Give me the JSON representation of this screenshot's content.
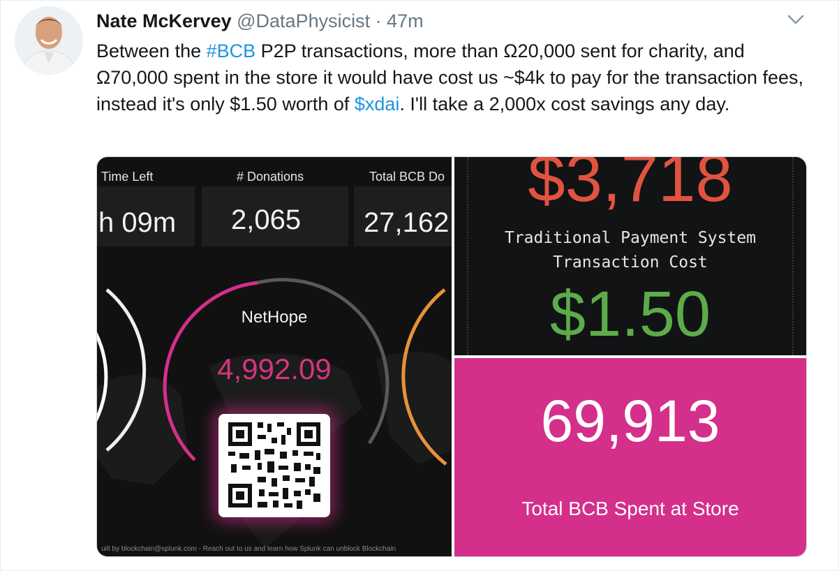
{
  "tweet": {
    "author_name": "Nate McKervey",
    "handle": "@DataPhysicist",
    "separator": "·",
    "time": "47m",
    "text_parts": [
      "Between the ",
      "#BCB",
      " P2P transactions, more than Ω20,000 sent for charity, and Ω70,000 spent in the store it would have cost us ~$4k to pay for the transaction fees, instead it's only $1.50 worth of ",
      "$xdai",
      ". I'll take a 2,000x cost savings any day."
    ]
  },
  "media": {
    "left": {
      "labels": [
        "Time Left",
        "# Donations",
        "Total BCB Do"
      ],
      "values": [
        "h 09m",
        "2,065",
        "27,162."
      ],
      "org_name": "NetHope",
      "org_amount": "4,992.09",
      "footer": "uilt by blockchain@splunk.com - Reach out to us and learn how Splunk can unblock Blockchain"
    },
    "top_right": {
      "big_cost": "$3,718",
      "caption_line1": "Traditional Payment System",
      "caption_line2": "Transaction Cost",
      "small_cost": "$1.50"
    },
    "bottom_right": {
      "value": "69,913",
      "label": "Total BCB Spent at Store"
    }
  },
  "colors": {
    "link": "#1b95e0",
    "pink": "#d42f8b",
    "red": "#e2533f",
    "green": "#5cac4a"
  }
}
